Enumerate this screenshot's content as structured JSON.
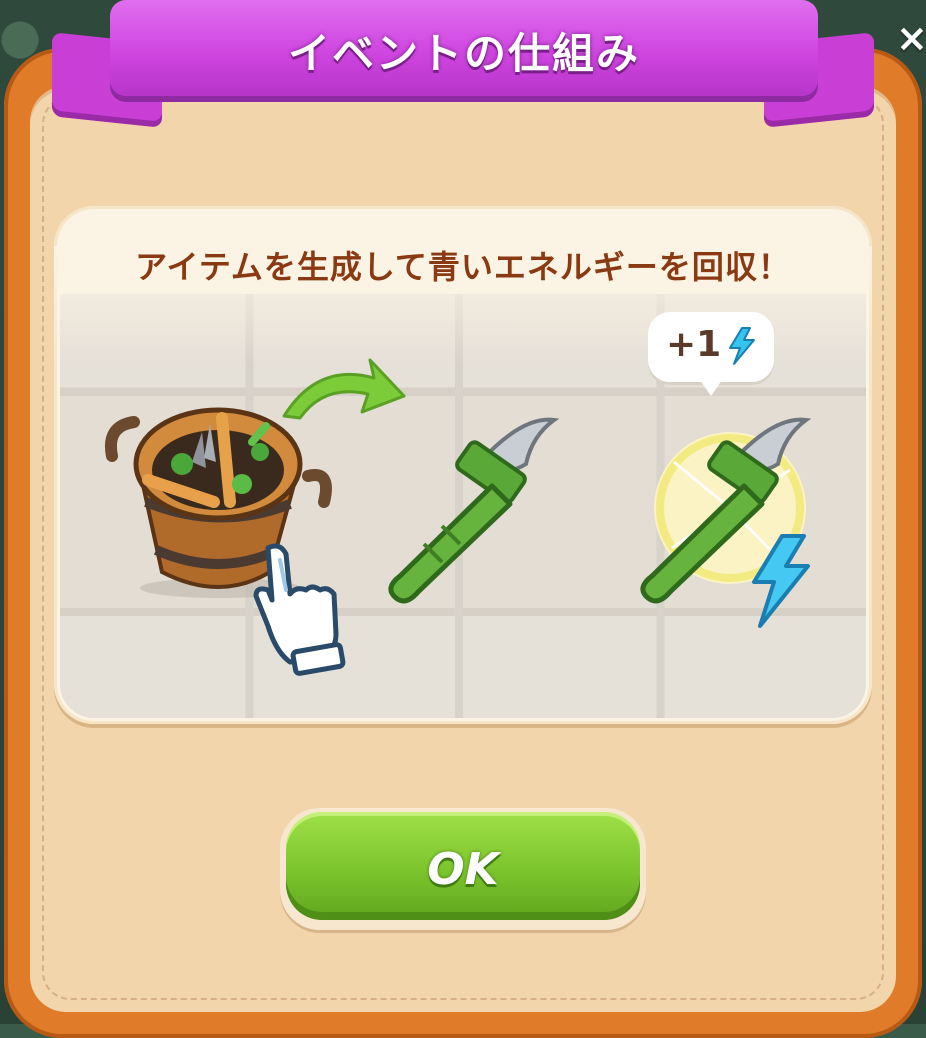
{
  "dialog": {
    "title": "イベントの仕組み",
    "close_label": "×"
  },
  "tutorial": {
    "heading": "アイテムを生成して青いエネルギーを回収！",
    "reward_text": "+1",
    "steps": [
      "basket-generator",
      "sickle-item",
      "sickle-energy-collect"
    ]
  },
  "buttons": {
    "ok_label": "OK"
  },
  "colors": {
    "ribbon": "#cf46e0",
    "frame": "#e07b2a",
    "button": "#7cc42c",
    "energy": "#36c3f0",
    "heading_text": "#8a3a12"
  }
}
